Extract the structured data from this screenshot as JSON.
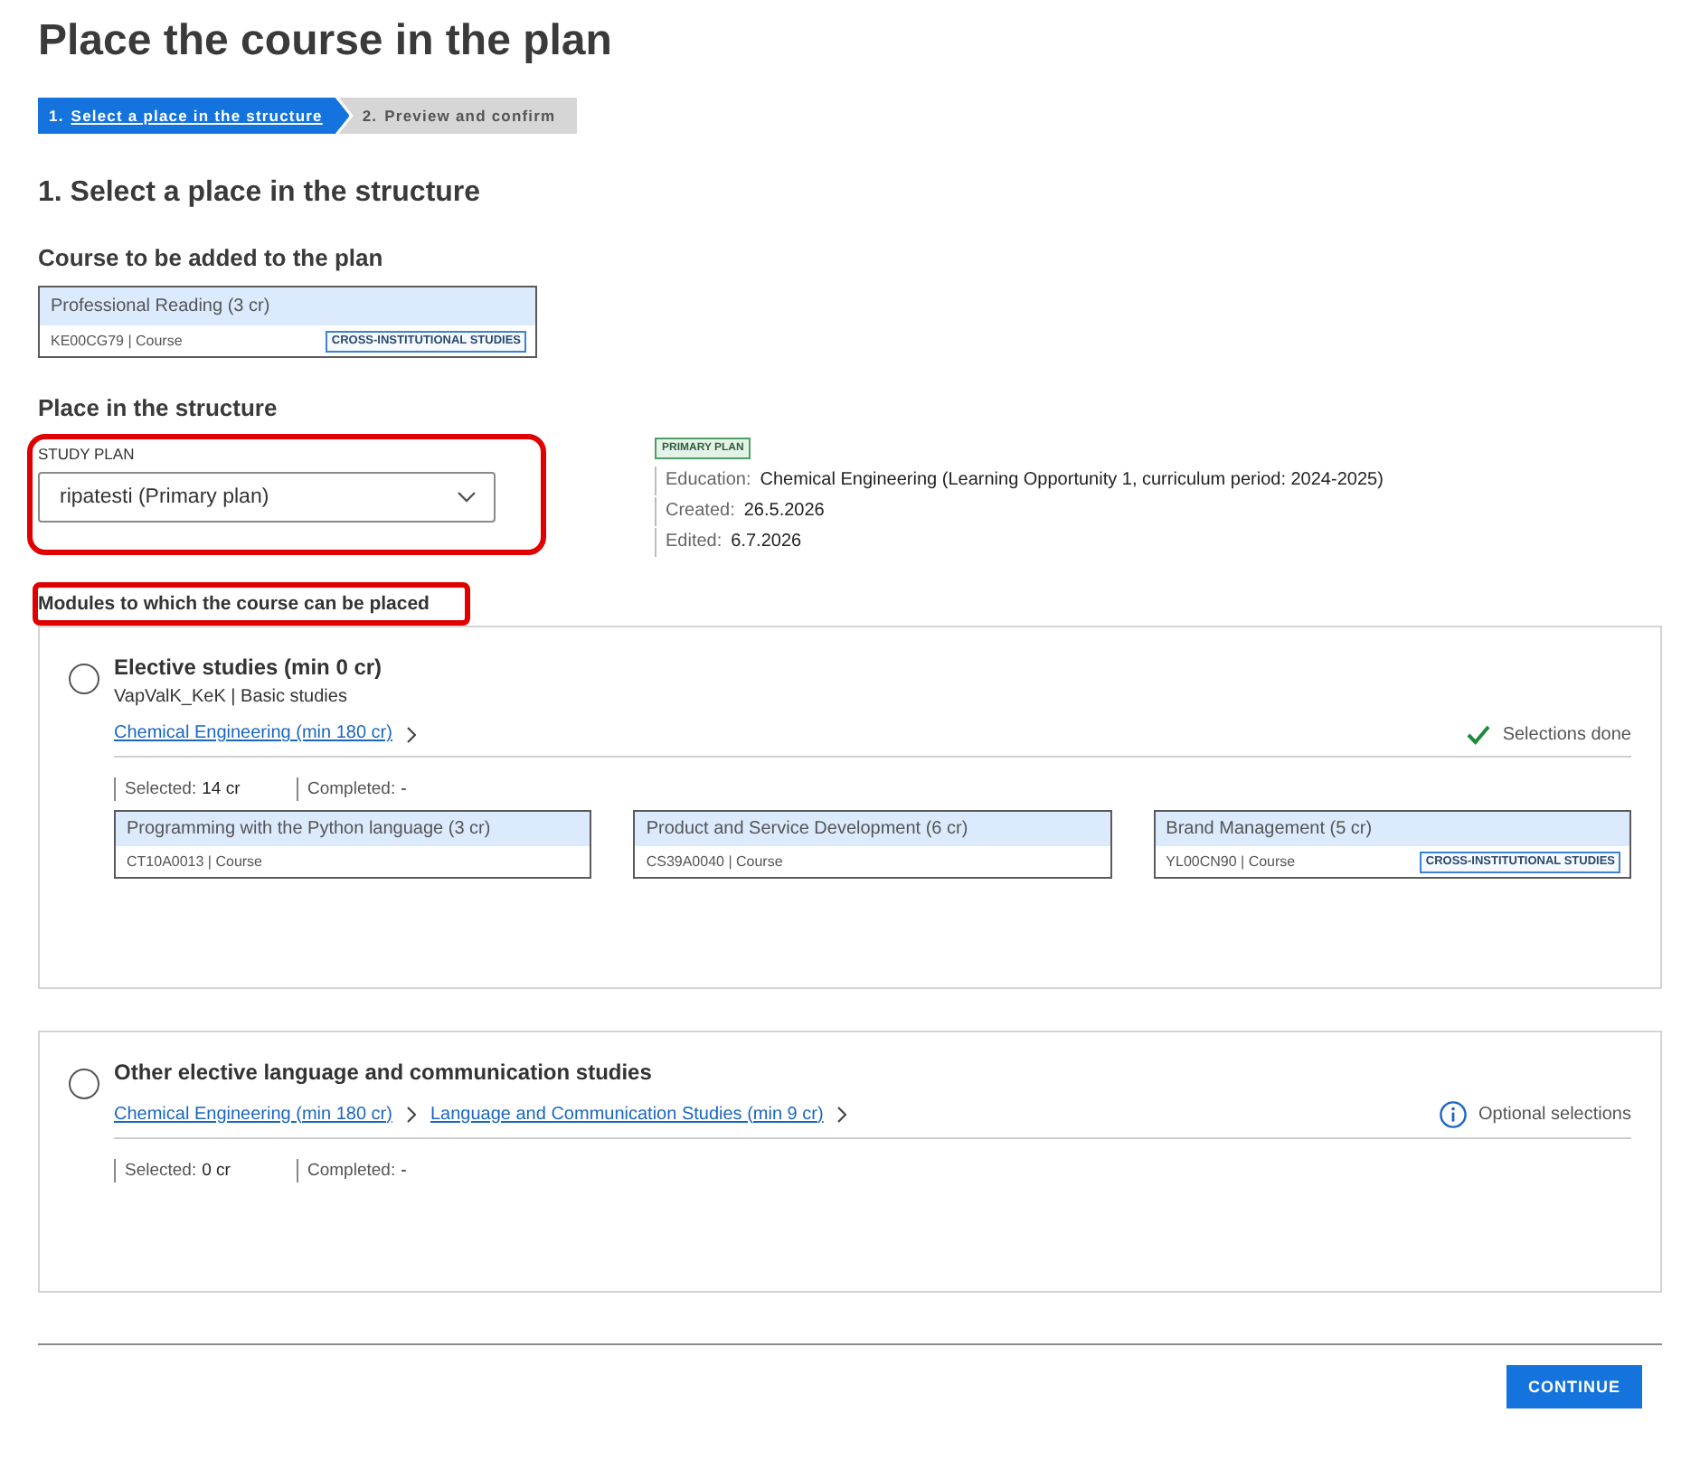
{
  "page": {
    "title": "Place the course in the plan"
  },
  "steps": [
    {
      "number": "1.",
      "label": "Select a place in the structure",
      "selected": true
    },
    {
      "number": "2.",
      "label": "Preview and confirm",
      "selected": false
    }
  ],
  "section_title": "1. Select a place in the structure",
  "course_to_add": {
    "heading": "Course to be added to the plan",
    "course": {
      "name": "Professional Reading (3 cr)",
      "meta": "KE00CG79 | Course",
      "badge": "CROSS-INSTITUTIONAL STUDIES"
    }
  },
  "place": {
    "heading": "Place in the structure",
    "study_plan": {
      "label": "STUDY PLAN",
      "value": "ripatesti (Primary plan)",
      "highlighted": true
    },
    "plan_info": {
      "badge": "PRIMARY PLAN",
      "rows": [
        {
          "label": "Education:",
          "value": "Chemical Engineering (Learning Opportunity 1, curriculum period: 2024-2025)"
        },
        {
          "label": "Created:",
          "value": "26.5.2026"
        },
        {
          "label": "Edited:",
          "value": "6.7.2026"
        }
      ]
    }
  },
  "modules": {
    "heading": "Modules to which the course can be placed",
    "highlighted": true,
    "items": [
      {
        "title": "Elective studies (min 0 cr)",
        "selected": false,
        "subtitle": "VapValK_KeK | Basic studies",
        "breadcrumbs": [
          "Chemical Engineering (min 180 cr)"
        ],
        "status": {
          "kind": "done",
          "text": "Selections done"
        },
        "stats": [
          {
            "label": "Selected:",
            "value": "14 cr"
          },
          {
            "label": "Completed:",
            "value": "-"
          }
        ],
        "courses": [
          {
            "name": "Programming with the Python language (3 cr)",
            "meta": "CT10A0013 | Course"
          },
          {
            "name": "Product and Service Development (6 cr)",
            "meta": "CS39A0040 | Course"
          },
          {
            "name": "Brand Management (5 cr)",
            "meta": "YL00CN90 | Course",
            "badge": "CROSS-INSTITUTIONAL STUDIES"
          }
        ]
      },
      {
        "title": "Other elective language and communication studies",
        "selected": false,
        "breadcrumbs": [
          "Chemical Engineering (min 180 cr)",
          "Language and Communication Studies (min 9 cr)"
        ],
        "status": {
          "kind": "optional",
          "text": "Optional selections"
        },
        "stats": [
          {
            "label": "Selected:",
            "value": "0 cr"
          },
          {
            "label": "Completed:",
            "value": "-"
          }
        ]
      }
    ]
  },
  "footer": {
    "button": "CONTINUE"
  }
}
